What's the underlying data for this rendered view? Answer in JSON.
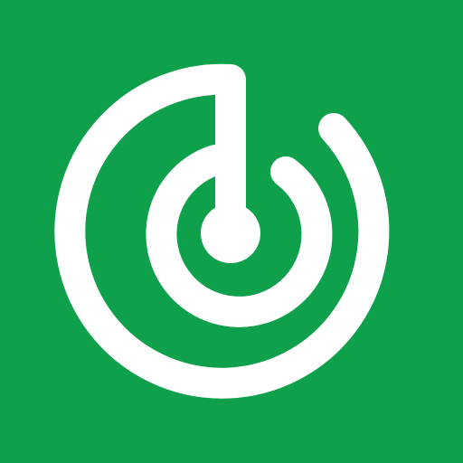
{
  "app_icon": {
    "icon": "radar-icon",
    "colors": {
      "background": "#0ea04b",
      "foreground": "#ffffff"
    }
  }
}
